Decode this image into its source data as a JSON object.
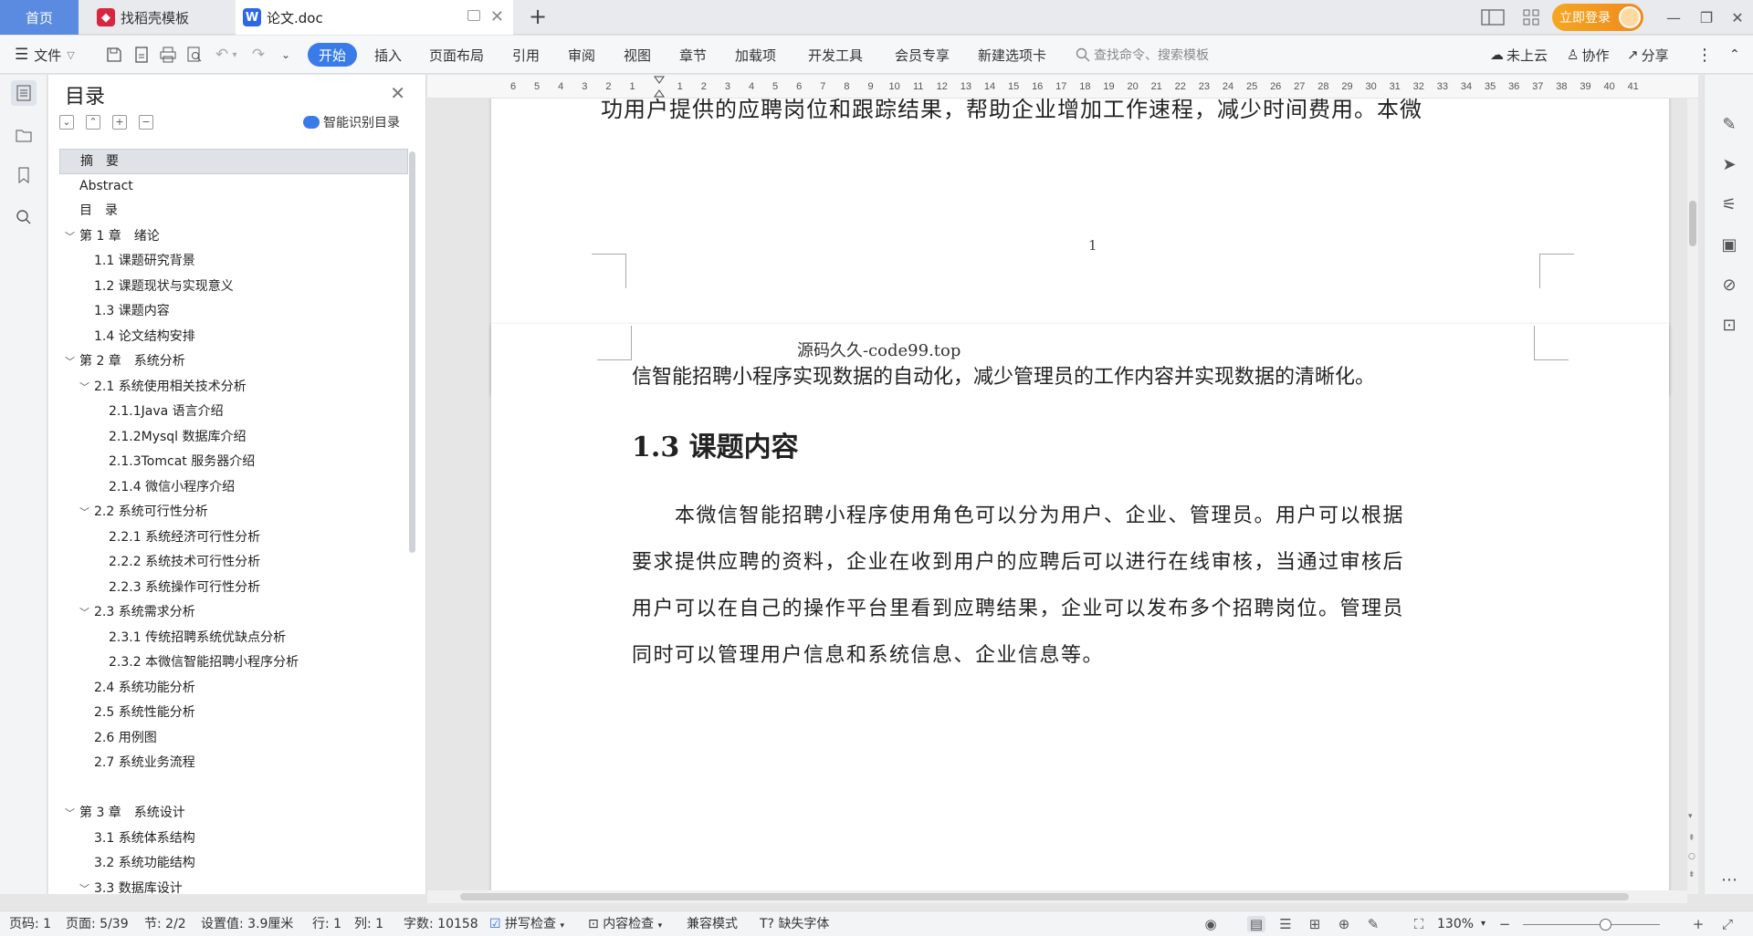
{
  "titlebar": {
    "home_tab": "首页",
    "template_tab": "找稻壳模板",
    "template_icon": "docer-icon",
    "doc_tab": "论文.doc",
    "doc_icon": "wps-w-icon",
    "login_label": "立即登录"
  },
  "ribbon": {
    "file_label": "文件",
    "tabs": [
      "开始",
      "插入",
      "页面布局",
      "引用",
      "审阅",
      "视图",
      "章节",
      "加载项",
      "开发工具",
      "会员专享",
      "新建选项卡"
    ],
    "search_placeholder": "查找命令、搜索模板",
    "cloud_label": "未上云",
    "collab_label": "协作",
    "share_label": "分享"
  },
  "toc": {
    "title": "目录",
    "smart_label": "智能识别目录",
    "items": [
      {
        "text": "摘　要",
        "level": 0,
        "expand": false,
        "selected": true
      },
      {
        "text": "Abstract",
        "level": 0,
        "expand": false
      },
      {
        "text": "目　录",
        "level": 0,
        "expand": false
      },
      {
        "text": "第 1 章　绪论",
        "level": 0,
        "expand": true
      },
      {
        "text": "1.1 课题研究背景",
        "level": 1,
        "expand": false
      },
      {
        "text": "1.2 课题现状与实现意义",
        "level": 1,
        "expand": false
      },
      {
        "text": "1.3 课题内容",
        "level": 1,
        "expand": false
      },
      {
        "text": "1.4 论文结构安排",
        "level": 1,
        "expand": false
      },
      {
        "text": "第 2 章　系统分析",
        "level": 0,
        "expand": true
      },
      {
        "text": "2.1 系统使用相关技术分析",
        "level": 1,
        "expand": true
      },
      {
        "text": "2.1.1Java 语言介绍",
        "level": 2,
        "expand": false
      },
      {
        "text": "2.1.2Mysql 数据库介绍",
        "level": 2,
        "expand": false
      },
      {
        "text": "2.1.3Tomcat 服务器介绍",
        "level": 2,
        "expand": false
      },
      {
        "text": "2.1.4 微信小程序介绍",
        "level": 2,
        "expand": false
      },
      {
        "text": "2.2 系统可行性分析",
        "level": 1,
        "expand": true
      },
      {
        "text": "2.2.1 系统经济可行性分析",
        "level": 2,
        "expand": false
      },
      {
        "text": "2.2.2 系统技术可行性分析",
        "level": 2,
        "expand": false
      },
      {
        "text": "2.2.3 系统操作可行性分析",
        "level": 2,
        "expand": false
      },
      {
        "text": "2.3 系统需求分析",
        "level": 1,
        "expand": true
      },
      {
        "text": "2.3.1 传统招聘系统优缺点分析",
        "level": 2,
        "expand": false
      },
      {
        "text": "2.3.2 本微信智能招聘小程序分析",
        "level": 2,
        "expand": false
      },
      {
        "text": "2.4 系统功能分析",
        "level": 1,
        "expand": false
      },
      {
        "text": "2.5 系统性能分析",
        "level": 1,
        "expand": false
      },
      {
        "text": "2.6 用例图",
        "level": 1,
        "expand": false
      },
      {
        "text": "2.7 系统业务流程",
        "level": 1,
        "expand": false
      },
      {
        "text": "",
        "level": 0,
        "expand": false
      },
      {
        "text": "第 3 章　系统设计",
        "level": 0,
        "expand": true
      },
      {
        "text": "3.1 系统体系结构",
        "level": 1,
        "expand": false
      },
      {
        "text": "3.2 系统功能结构",
        "level": 1,
        "expand": false
      },
      {
        "text": "3.3 数据库设计",
        "level": 1,
        "expand": true
      }
    ]
  },
  "ruler": {
    "ticks": [
      "6",
      "5",
      "4",
      "3",
      "2",
      "1",
      "",
      "1",
      "2",
      "3",
      "4",
      "5",
      "6",
      "7",
      "8",
      "9",
      "10",
      "11",
      "12",
      "13",
      "14",
      "15",
      "16",
      "17",
      "18",
      "19",
      "20",
      "21",
      "22",
      "23",
      "24",
      "25",
      "26",
      "27",
      "28",
      "29",
      "30",
      "31",
      "32",
      "33",
      "34",
      "35",
      "36",
      "37",
      "38",
      "39",
      "40",
      "41"
    ]
  },
  "document": {
    "page1_tail": "功用户提供的应聘岗位和跟踪结果，帮助企业增加工作速程，减少时间费用。本微",
    "page1_number": "1",
    "watermark": "源码久久-code99.top",
    "page2_first_line": "信智能招聘小程序实现数据的自动化，减少管理员的工作内容并实现数据的清晰化。",
    "heading": "1.3 课题内容",
    "para_lines": [
      "　　本微信智能招聘小程序使用角色可以分为用户、企业、管理员。用户可以根据",
      "要求提供应聘的资料，企业在收到用户的应聘后可以进行在线审核，当通过审核后",
      "用户可以在自己的操作平台里看到应聘结果，企业可以发布多个招聘岗位。管理员",
      "同时可以管理用户信息和系统信息、企业信息等。"
    ]
  },
  "status": {
    "page_no": "页码: 1",
    "pages": "页面: 5/39",
    "section": "节: 2/2",
    "setting": "设置值: 3.9厘米",
    "row": "行: 1",
    "col": "列: 1",
    "words": "字数: 10158",
    "spell": "拼写检查",
    "content_check": "内容检查",
    "compat": "兼容模式",
    "missing_font": "缺失字体",
    "zoom": "130%"
  }
}
